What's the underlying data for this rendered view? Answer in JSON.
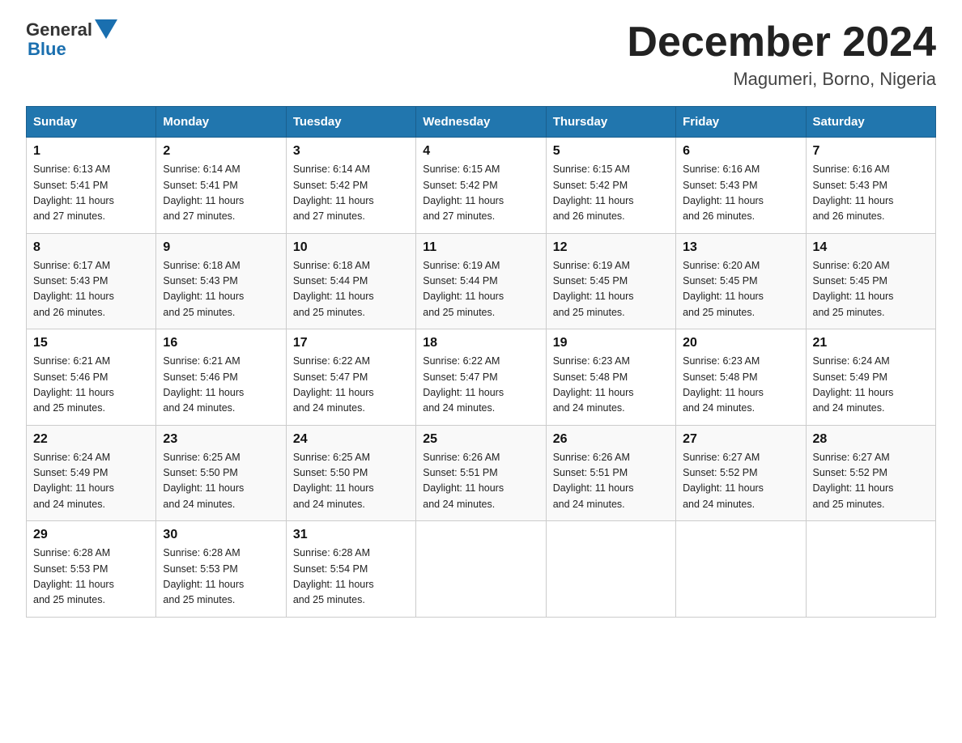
{
  "logo": {
    "text_general": "General",
    "text_blue": "Blue"
  },
  "title": {
    "month": "December 2024",
    "location": "Magumeri, Borno, Nigeria"
  },
  "days_header": [
    "Sunday",
    "Monday",
    "Tuesday",
    "Wednesday",
    "Thursday",
    "Friday",
    "Saturday"
  ],
  "weeks": [
    [
      {
        "num": "1",
        "sunrise": "6:13 AM",
        "sunset": "5:41 PM",
        "daylight": "11 hours and 27 minutes."
      },
      {
        "num": "2",
        "sunrise": "6:14 AM",
        "sunset": "5:41 PM",
        "daylight": "11 hours and 27 minutes."
      },
      {
        "num": "3",
        "sunrise": "6:14 AM",
        "sunset": "5:42 PM",
        "daylight": "11 hours and 27 minutes."
      },
      {
        "num": "4",
        "sunrise": "6:15 AM",
        "sunset": "5:42 PM",
        "daylight": "11 hours and 27 minutes."
      },
      {
        "num": "5",
        "sunrise": "6:15 AM",
        "sunset": "5:42 PM",
        "daylight": "11 hours and 26 minutes."
      },
      {
        "num": "6",
        "sunrise": "6:16 AM",
        "sunset": "5:43 PM",
        "daylight": "11 hours and 26 minutes."
      },
      {
        "num": "7",
        "sunrise": "6:16 AM",
        "sunset": "5:43 PM",
        "daylight": "11 hours and 26 minutes."
      }
    ],
    [
      {
        "num": "8",
        "sunrise": "6:17 AM",
        "sunset": "5:43 PM",
        "daylight": "11 hours and 26 minutes."
      },
      {
        "num": "9",
        "sunrise": "6:18 AM",
        "sunset": "5:43 PM",
        "daylight": "11 hours and 25 minutes."
      },
      {
        "num": "10",
        "sunrise": "6:18 AM",
        "sunset": "5:44 PM",
        "daylight": "11 hours and 25 minutes."
      },
      {
        "num": "11",
        "sunrise": "6:19 AM",
        "sunset": "5:44 PM",
        "daylight": "11 hours and 25 minutes."
      },
      {
        "num": "12",
        "sunrise": "6:19 AM",
        "sunset": "5:45 PM",
        "daylight": "11 hours and 25 minutes."
      },
      {
        "num": "13",
        "sunrise": "6:20 AM",
        "sunset": "5:45 PM",
        "daylight": "11 hours and 25 minutes."
      },
      {
        "num": "14",
        "sunrise": "6:20 AM",
        "sunset": "5:45 PM",
        "daylight": "11 hours and 25 minutes."
      }
    ],
    [
      {
        "num": "15",
        "sunrise": "6:21 AM",
        "sunset": "5:46 PM",
        "daylight": "11 hours and 25 minutes."
      },
      {
        "num": "16",
        "sunrise": "6:21 AM",
        "sunset": "5:46 PM",
        "daylight": "11 hours and 24 minutes."
      },
      {
        "num": "17",
        "sunrise": "6:22 AM",
        "sunset": "5:47 PM",
        "daylight": "11 hours and 24 minutes."
      },
      {
        "num": "18",
        "sunrise": "6:22 AM",
        "sunset": "5:47 PM",
        "daylight": "11 hours and 24 minutes."
      },
      {
        "num": "19",
        "sunrise": "6:23 AM",
        "sunset": "5:48 PM",
        "daylight": "11 hours and 24 minutes."
      },
      {
        "num": "20",
        "sunrise": "6:23 AM",
        "sunset": "5:48 PM",
        "daylight": "11 hours and 24 minutes."
      },
      {
        "num": "21",
        "sunrise": "6:24 AM",
        "sunset": "5:49 PM",
        "daylight": "11 hours and 24 minutes."
      }
    ],
    [
      {
        "num": "22",
        "sunrise": "6:24 AM",
        "sunset": "5:49 PM",
        "daylight": "11 hours and 24 minutes."
      },
      {
        "num": "23",
        "sunrise": "6:25 AM",
        "sunset": "5:50 PM",
        "daylight": "11 hours and 24 minutes."
      },
      {
        "num": "24",
        "sunrise": "6:25 AM",
        "sunset": "5:50 PM",
        "daylight": "11 hours and 24 minutes."
      },
      {
        "num": "25",
        "sunrise": "6:26 AM",
        "sunset": "5:51 PM",
        "daylight": "11 hours and 24 minutes."
      },
      {
        "num": "26",
        "sunrise": "6:26 AM",
        "sunset": "5:51 PM",
        "daylight": "11 hours and 24 minutes."
      },
      {
        "num": "27",
        "sunrise": "6:27 AM",
        "sunset": "5:52 PM",
        "daylight": "11 hours and 24 minutes."
      },
      {
        "num": "28",
        "sunrise": "6:27 AM",
        "sunset": "5:52 PM",
        "daylight": "11 hours and 25 minutes."
      }
    ],
    [
      {
        "num": "29",
        "sunrise": "6:28 AM",
        "sunset": "5:53 PM",
        "daylight": "11 hours and 25 minutes."
      },
      {
        "num": "30",
        "sunrise": "6:28 AM",
        "sunset": "5:53 PM",
        "daylight": "11 hours and 25 minutes."
      },
      {
        "num": "31",
        "sunrise": "6:28 AM",
        "sunset": "5:54 PM",
        "daylight": "11 hours and 25 minutes."
      },
      null,
      null,
      null,
      null
    ]
  ],
  "labels": {
    "sunrise": "Sunrise:",
    "sunset": "Sunset:",
    "daylight": "Daylight:"
  }
}
